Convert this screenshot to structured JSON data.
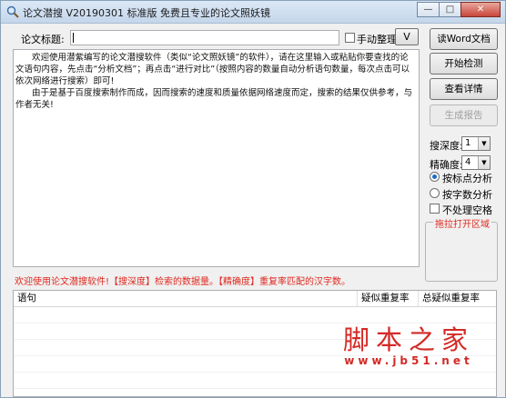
{
  "window": {
    "title": "论文潜搜 V20190301 标准版 免费且专业的论文照妖镜",
    "title_icon": "magnifier-icon"
  },
  "form": {
    "title_label": "论文标题:",
    "title_value": "",
    "auto_tidy_label": "手动整理",
    "auto_tidy_checked": false,
    "v_button": "V"
  },
  "content": {
    "paragraphs": [
      "欢迎使用潜紫编写的论文潜搜软件（类似“论文照妖镜”的软件），请在这里输入或粘贴你要查找的论文语句内容，先点击“分析文档”；再点击“进行对比”（按照内容的数量自动分析语句数量，每次点击可以依次网络进行搜索）即可!",
      "由于是基于百度搜索制作而成，因而搜索的速度和质量依据网络速度而定，搜索的结果仅供参考，与作者无关!"
    ]
  },
  "side": {
    "btn_read_word": "读Word文档",
    "btn_start": "开始检测",
    "btn_details": "查看详情",
    "btn_report": "生成报告",
    "depth_label": "搜深度:",
    "depth_value": "1",
    "precision_label": "精确度:",
    "precision_value": "4",
    "radio_punct": "按标点分析",
    "radio_chars": "按字数分析",
    "radio_selected": "punct",
    "ignore_spaces_label": "不处理空格",
    "ignore_spaces_checked": false,
    "drag_title": "拖拉打开区域"
  },
  "notice": "欢迎使用论文潜搜软件!【搜深度】检索的数据量。【精确度】重复率匹配的汉字数。",
  "grid": {
    "columns": [
      "语句",
      "疑似重复率",
      "总疑似重复率"
    ],
    "rows": []
  },
  "watermark": {
    "main": "脚本之家",
    "url": "www.jb51.net"
  },
  "colors": {
    "accent_red": "#e0281f",
    "selected_blue": "#1c6bc9"
  }
}
